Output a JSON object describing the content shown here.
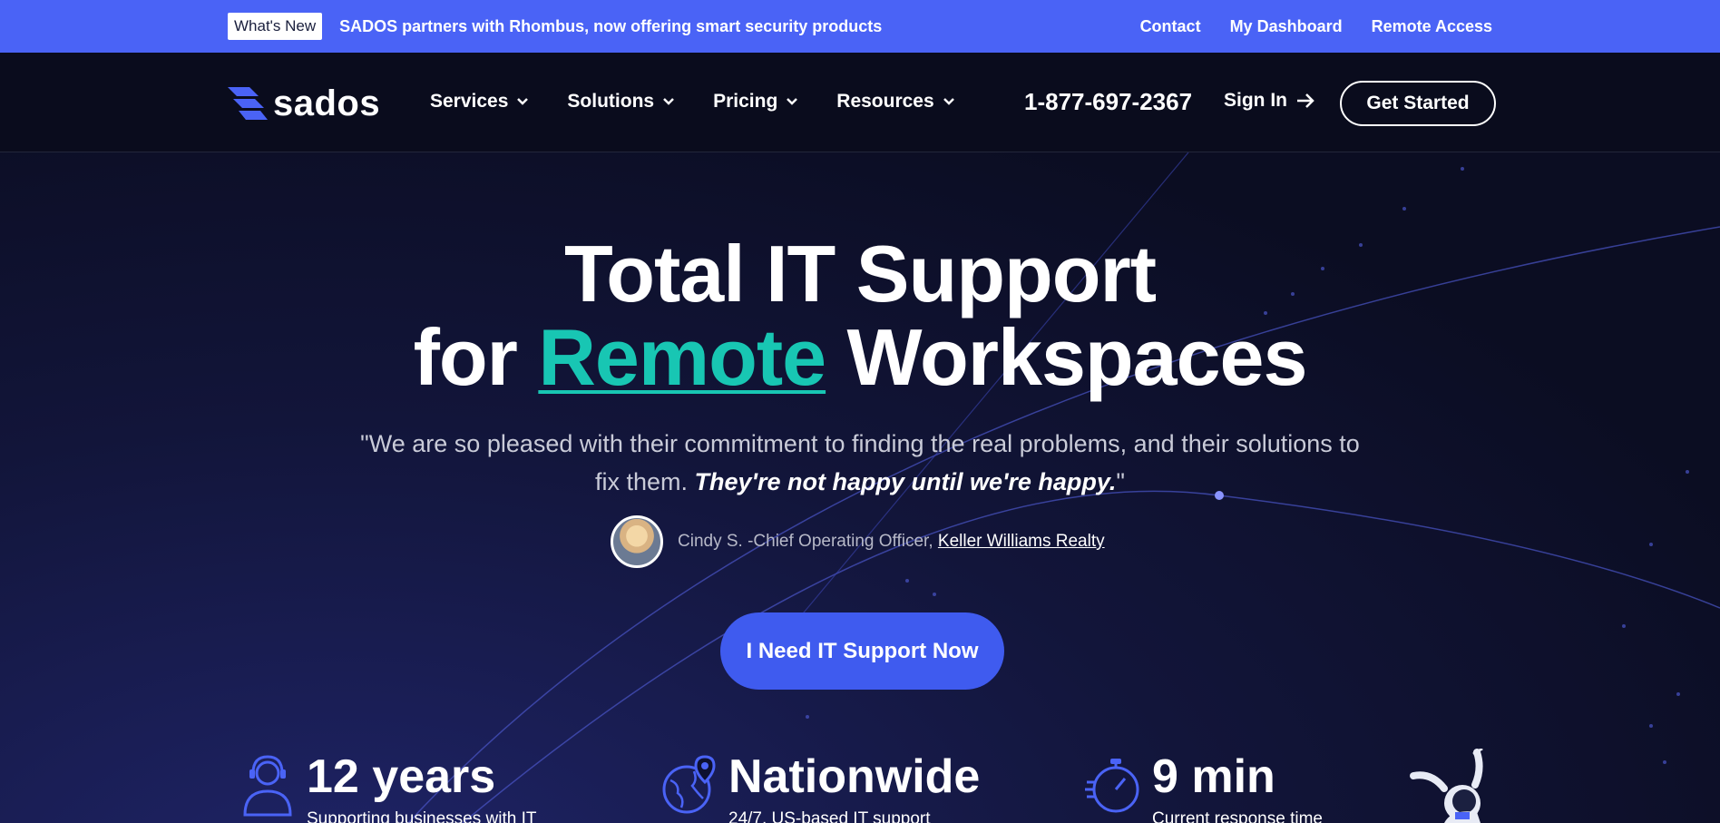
{
  "announcement": {
    "badge": "What's New",
    "text": "SADOS partners with Rhombus, now offering smart security products",
    "links": [
      "Contact",
      "My Dashboard",
      "Remote Access"
    ]
  },
  "nav": {
    "logo_text": "sados",
    "menu": [
      "Services",
      "Solutions",
      "Pricing",
      "Resources"
    ],
    "phone": "1-877-697-2367",
    "sign_in": "Sign In",
    "get_started": "Get Started"
  },
  "hero": {
    "title_line1": "Total IT Support",
    "title_line2_prefix": "for ",
    "title_line2_accent": "Remote",
    "title_line2_suffix": " Workspaces",
    "quote_main": "\"We are so pleased with their commitment to finding the real problems, and their solutions to fix them. ",
    "quote_emphasis": "They're not happy until we're happy.",
    "quote_end": "\"",
    "attribution_prefix": "Cindy S. -Chief Operating Officer, ",
    "attribution_company": "Keller Williams Realty",
    "cta": "I Need IT Support Now"
  },
  "stats": [
    {
      "number": "12 years",
      "desc": "Supporting businesses with IT",
      "icon": "headset-person-icon"
    },
    {
      "number": "Nationwide",
      "desc": "24/7, US-based IT support",
      "icon": "globe-pin-icon"
    },
    {
      "number": "9 min",
      "desc": "Current response time",
      "icon": "stopwatch-icon"
    }
  ],
  "colors": {
    "topbar": "#4a63f6",
    "nav_bg": "#0a0c1d",
    "accent_teal": "#18c6b3",
    "cta": "#3f5bef"
  }
}
